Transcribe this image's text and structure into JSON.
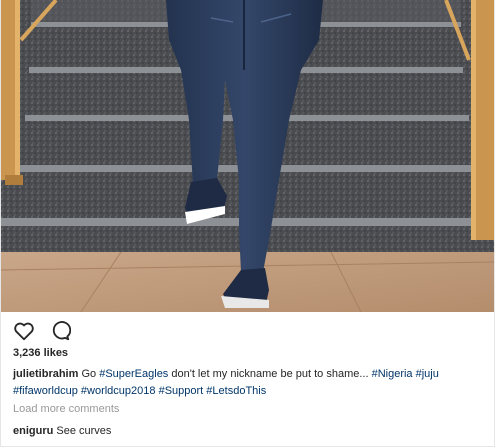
{
  "post": {
    "photo": {
      "description_icon": "photo-icon"
    },
    "actions": {
      "like_icon": "heart-icon",
      "comment_icon": "comment-bubble-icon"
    },
    "likes_text": "3,236 likes",
    "caption": {
      "username": "julietibrahim",
      "text_1": " Go ",
      "tag_1": "#SuperEagles",
      "text_2": " don't let my nickname be put to shame... ",
      "tag_2": "#Nigeria",
      "tag_3": "#juju",
      "tag_4": "#fifaworldcup",
      "tag_5": "#worldcup2018",
      "tag_6": "#Support",
      "tag_7": "#LetsdoThis"
    },
    "load_more": "Load more comments",
    "comments": [
      {
        "username": "eniguru",
        "text": " See curves"
      }
    ]
  },
  "colors": {
    "hashtag": "#003569",
    "muted": "#999999",
    "text": "#262626"
  }
}
